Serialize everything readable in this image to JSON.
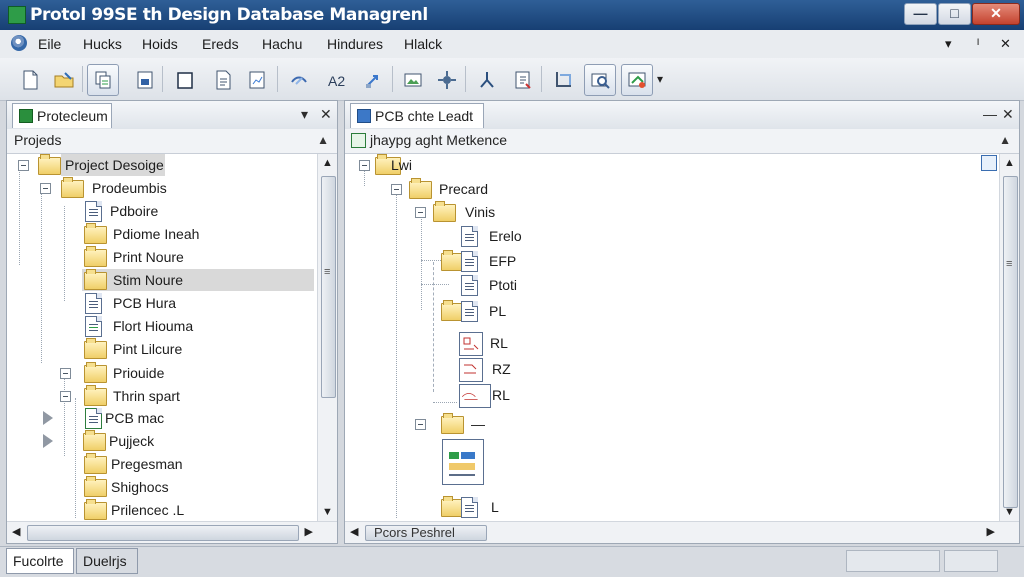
{
  "window": {
    "title": "Protol 99SE  th Design Database Managrenl",
    "minimize_label": "—",
    "maximize_label": "□",
    "close_label": "✕"
  },
  "menu": {
    "items": [
      "Eile",
      "Hucks",
      "Hoids",
      "Ereds",
      "Hachu",
      "Hindures",
      "Hlalck"
    ],
    "right_dropdown": "▾",
    "right_pin": "ᴵ",
    "right_close": "✕"
  },
  "toolbar": {
    "items": [
      "new-doc",
      "open-folder",
      "copy-doc",
      "save-doc",
      "window",
      "report",
      "chart-doc",
      "pen-tool",
      "text-a2",
      "arrow-tool",
      "image-tool",
      "settings-tool",
      "route-tool",
      "edit-tool",
      "crop-tool",
      "browse-tool",
      "export-tool"
    ],
    "overflow": "▾"
  },
  "left_panel": {
    "tab_label": "Protecleum",
    "header_pin": "▾",
    "header_close": "✕",
    "subheader": "Projeds",
    "tree": [
      {
        "label": "Project Desoige",
        "kind": "folder"
      },
      {
        "label": "Prodeumbis",
        "kind": "folder"
      },
      {
        "label": "Pdboire",
        "kind": "doc"
      },
      {
        "label": "Pdiome Ineah",
        "kind": "folder"
      },
      {
        "label": "Print Noure",
        "kind": "folder"
      },
      {
        "label": "Stim Noure",
        "kind": "folder",
        "selected": true
      },
      {
        "label": "PCB Hura",
        "kind": "doc"
      },
      {
        "label": "Flort Hiouma",
        "kind": "doc"
      },
      {
        "label": "Pint Lilcure",
        "kind": "folder"
      },
      {
        "label": "Priouide",
        "kind": "folder"
      },
      {
        "label": "Thrin spart",
        "kind": "folder"
      },
      {
        "label": "PCB mac",
        "kind": "doc"
      },
      {
        "label": "Pujjeck",
        "kind": "folder"
      },
      {
        "label": "Pregesman",
        "kind": "folder"
      },
      {
        "label": "Shighocs",
        "kind": "folder"
      },
      {
        "label": "Prilencec .L",
        "kind": "folder"
      }
    ]
  },
  "right_panel": {
    "tab_label": "PCB chte Leadt",
    "header_min": "—",
    "header_close": "✕",
    "subheader": "jhaypg aght Metkence",
    "tree": [
      {
        "label": "Lwi",
        "kind": "folder"
      },
      {
        "label": "Precard",
        "kind": "folder"
      },
      {
        "label": "Vinis",
        "kind": "folder"
      },
      {
        "label": "Erelo",
        "kind": "doc"
      },
      {
        "label": "EFP",
        "kind": "folder-doc"
      },
      {
        "label": "Ptoti",
        "kind": "doc"
      },
      {
        "label": "PL",
        "kind": "folder-doc"
      },
      {
        "label": "RL",
        "kind": "schematic"
      },
      {
        "label": "RZ",
        "kind": "schematic"
      },
      {
        "label": "RL",
        "kind": "schematic"
      },
      {
        "label": "—",
        "kind": "folder"
      },
      {
        "label": "",
        "kind": "big-doc"
      },
      {
        "label": "L",
        "kind": "folder-doc"
      }
    ],
    "footer_text": "Pcors Peshrel"
  },
  "status": {
    "tabs": [
      "Fucolrte",
      "Duelrjs"
    ]
  },
  "colors": {
    "title_bar": "#1f4f8f",
    "selection": "#d9d9d9",
    "folder": "#f0cf68",
    "accent_green": "#2e9c48"
  }
}
